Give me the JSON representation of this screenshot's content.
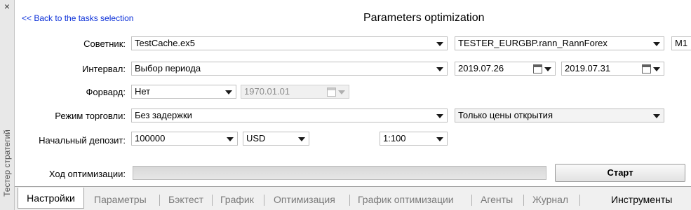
{
  "sidebar": {
    "close": "×",
    "title": "Тестер стратегий"
  },
  "header": {
    "back_link": "<< Back to the tasks selection",
    "title": "Parameters optimization"
  },
  "form": {
    "expert": {
      "label": "Советник:",
      "value": "TestCache.ex5"
    },
    "symbol": {
      "value": "TESTER_EURGBP.rann_RannForex"
    },
    "timeframe": {
      "value": "M1"
    },
    "interval": {
      "label": "Интервал:",
      "value": "Выбор периода",
      "date_from": "2019.07.26",
      "date_to": "2019.07.31"
    },
    "forward": {
      "label": "Форвард:",
      "value": "Нет",
      "date": "1970.01.01"
    },
    "trade_mode": {
      "label": "Режим торговли:",
      "delay": "Без задержки",
      "model": "Только цены открытия"
    },
    "deposit": {
      "label": "Начальный депозит:",
      "amount": "100000",
      "currency": "USD",
      "leverage": "1:100"
    }
  },
  "progress": {
    "label": "Ход оптимизации:",
    "percent": 0
  },
  "start_label": "Старт",
  "tabs": [
    "Настройки",
    "Параметры",
    "Бэктест",
    "График",
    "Оптимизация",
    "График оптимизации",
    "Агенты",
    "Журнал"
  ],
  "tools_label": "Инструменты",
  "icons": {
    "dropdown": "chevron-down-icon",
    "calendar": "calendar-icon"
  },
  "colors": {
    "link": "#0a2fd8",
    "panel_bg": "#ffffff",
    "frame_bg": "#f0f0f0"
  }
}
